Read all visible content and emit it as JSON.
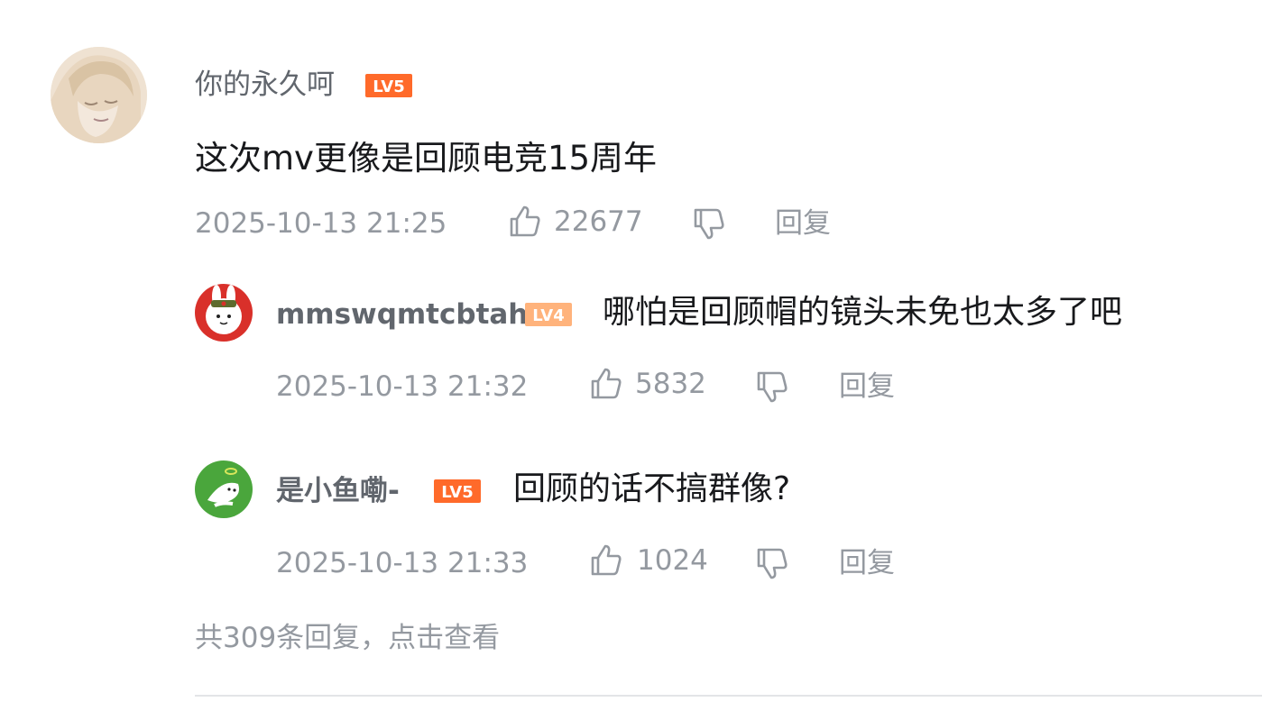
{
  "comment": {
    "username": "你的永久呵",
    "level": "LV5",
    "text": "这次mv更像是回顾电竞15周年",
    "timestamp": "2025-10-13 21:25",
    "likes": "22677",
    "reply_label": "回复"
  },
  "replies": [
    {
      "username": "mmswqmtcbtah",
      "level": "LV4",
      "text": "哪怕是回顾帽的镜头未免也太多了吧",
      "timestamp": "2025-10-13 21:32",
      "likes": "5832",
      "reply_label": "回复"
    },
    {
      "username": "是小鱼嘞-",
      "level": "LV5",
      "text": "回顾的话不搞群像?",
      "timestamp": "2025-10-13 21:33",
      "likes": "1024",
      "reply_label": "回复"
    }
  ],
  "view_more": "共309条回复，点击查看",
  "colors": {
    "lv5": "#ff6a2a",
    "lv4": "#ffb37c",
    "meta": "#9499a0",
    "text": "#18191c",
    "username": "#61666d"
  },
  "icons": {
    "like": "thumbs-up-icon",
    "dislike": "thumbs-down-icon"
  }
}
